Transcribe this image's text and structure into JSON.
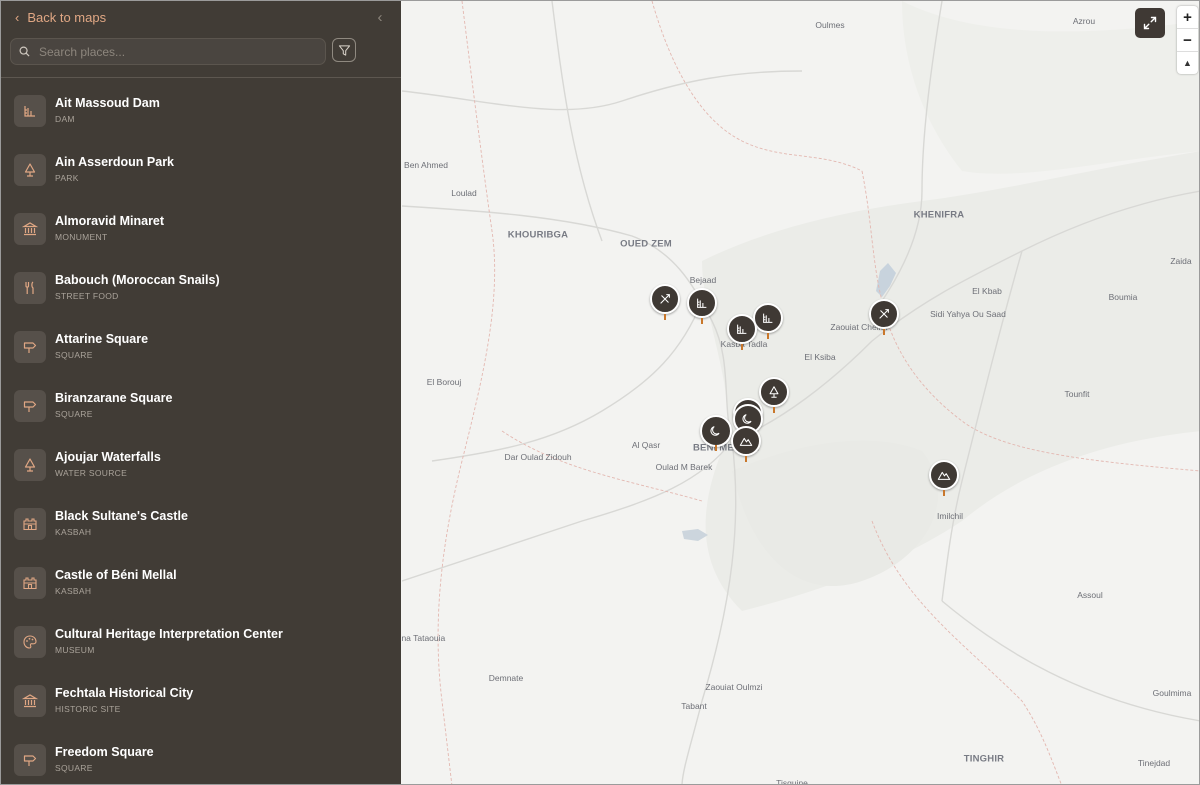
{
  "sidebar": {
    "back_label": "Back to maps",
    "search_placeholder": "Search places...",
    "items": [
      {
        "name": "Ait Massoud Dam",
        "category": "DAM",
        "icon": "dam-icon"
      },
      {
        "name": "Ain Asserdoun Park",
        "category": "PARK",
        "icon": "tree-icon"
      },
      {
        "name": "Almoravid Minaret",
        "category": "MONUMENT",
        "icon": "monument-icon"
      },
      {
        "name": "Babouch (Moroccan Snails)",
        "category": "STREET FOOD",
        "icon": "utensils-icon"
      },
      {
        "name": "Attarine Square",
        "category": "SQUARE",
        "icon": "signpost-icon"
      },
      {
        "name": "Biranzarane Square",
        "category": "SQUARE",
        "icon": "signpost-icon"
      },
      {
        "name": "Ajoujar Waterfalls",
        "category": "WATER SOURCE",
        "icon": "tree-icon"
      },
      {
        "name": "Black Sultane's Castle",
        "category": "KASBAH",
        "icon": "castle-icon"
      },
      {
        "name": "Castle of Béni Mellal",
        "category": "KASBAH",
        "icon": "castle-icon"
      },
      {
        "name": "Cultural Heritage Interpretation Center",
        "category": "MUSEUM",
        "icon": "palette-icon"
      },
      {
        "name": "Fechtala Historical City",
        "category": "HISTORIC SITE",
        "icon": "monument-icon"
      },
      {
        "name": "Freedom Square",
        "category": "SQUARE",
        "icon": "signpost-icon"
      }
    ]
  },
  "map": {
    "accent_color": "#e0a784",
    "marker_color": "#3f3934",
    "zoom_in": "+",
    "zoom_out": "−",
    "compass": "▲",
    "place_labels": [
      {
        "text": "Oulmes",
        "big": false
      },
      {
        "text": "Azrou",
        "big": false
      },
      {
        "text": "Ben Ahmed",
        "big": false
      },
      {
        "text": "Loulad",
        "big": false
      },
      {
        "text": "KHOURIBGA",
        "big": true
      },
      {
        "text": "OUED ZEM",
        "big": true
      },
      {
        "text": "KHENIFRA",
        "big": true
      },
      {
        "text": "Bejaad",
        "big": false
      },
      {
        "text": "Kasba Tadla",
        "big": false
      },
      {
        "text": "El Ksiba",
        "big": false
      },
      {
        "text": "Zaouiat Cheikh",
        "big": false
      },
      {
        "text": "Sidi Yahya Ou Saad",
        "big": false
      },
      {
        "text": "El Kbab",
        "big": false
      },
      {
        "text": "Zaida",
        "big": false
      },
      {
        "text": "Boumia",
        "big": false
      },
      {
        "text": "El Borouj",
        "big": false
      },
      {
        "text": "Tounfit",
        "big": false
      },
      {
        "text": "Al Qasr",
        "big": false
      },
      {
        "text": "BENI MELLAL",
        "big": true
      },
      {
        "text": "Oulad M Barek",
        "big": false
      },
      {
        "text": "Dar Oulad Zidouh",
        "big": false
      },
      {
        "text": "Imilchil",
        "big": false
      },
      {
        "text": "Assoul",
        "big": false
      },
      {
        "text": "Sraghna Tataouia",
        "big": false
      },
      {
        "text": "Demnate",
        "big": false
      },
      {
        "text": "Zaouiat Oulmzi",
        "big": false
      },
      {
        "text": "Tabant",
        "big": false
      },
      {
        "text": "Goulmima",
        "big": false
      },
      {
        "text": "TINGHIR",
        "big": true
      },
      {
        "text": "Tinejdad",
        "big": false
      },
      {
        "text": "Tisguine",
        "big": false
      }
    ],
    "markers": [
      {
        "icon": "compass-icon"
      },
      {
        "icon": "dam-icon"
      },
      {
        "icon": "dam-icon"
      },
      {
        "icon": "dam-icon"
      },
      {
        "icon": "compass-icon"
      },
      {
        "icon": "tree-icon"
      },
      {
        "icon": "moon-icon"
      },
      {
        "icon": "moon-icon"
      },
      {
        "icon": "moon-icon"
      },
      {
        "icon": "mountain-icon"
      },
      {
        "icon": "mountain-icon"
      }
    ]
  }
}
